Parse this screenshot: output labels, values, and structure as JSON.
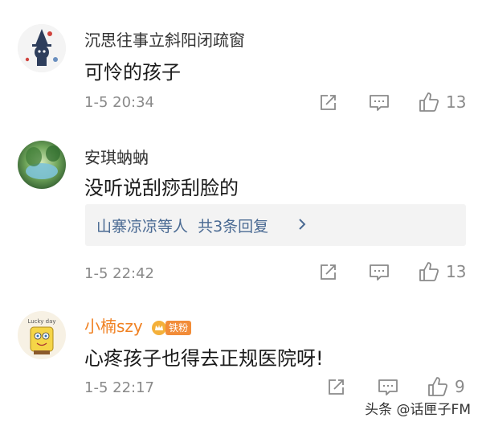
{
  "comments": [
    {
      "username": "沉思往事立斜阳闭疏窗",
      "text": "可怜的孩子",
      "timestamp": "1-5 20:34",
      "likes": "13"
    },
    {
      "username": "安琪蚋蚋",
      "text": "没听说刮痧刮脸的",
      "timestamp": "1-5 22:42",
      "likes": "13",
      "replies": {
        "names": "山寨凉凉等人",
        "count": "共3条回复"
      }
    },
    {
      "username": "小楠szy",
      "badge": "铁粉",
      "text": "心疼孩子也得去正规医院呀!",
      "timestamp": "1-5 22:17",
      "likes": "9",
      "avatar_text": "Lucky day"
    }
  ],
  "watermark": "头条 @话匣子FM",
  "colors": {
    "vip_username": "#f08122",
    "reply_link": "#4a6a93",
    "meta_gray": "#8a8a8a"
  }
}
